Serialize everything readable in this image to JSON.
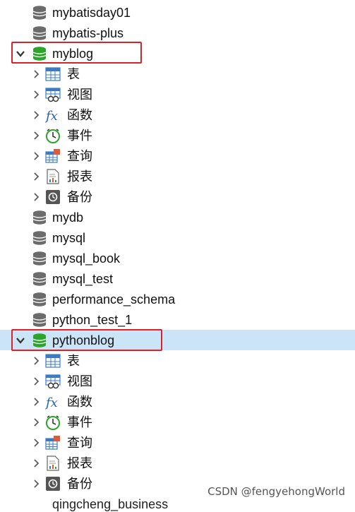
{
  "databases_top": [
    "mybatisday01",
    "mybatis-plus"
  ],
  "myblog": {
    "name": "myblog",
    "children": [
      "表",
      "视图",
      "函数",
      "事件",
      "查询",
      "报表",
      "备份"
    ]
  },
  "databases_mid": [
    "mydb",
    "mysql",
    "mysql_book",
    "mysql_test",
    "performance_schema",
    "python_test_1"
  ],
  "pythonblog": {
    "name": "pythonblog",
    "children": [
      "表",
      "视图",
      "函数",
      "事件",
      "查询",
      "报表",
      "备份"
    ]
  },
  "cut_off_db": "qingcheng_business",
  "watermark": "CSDN @fengyehongWorld",
  "colors": {
    "highlight_border": "#d9222a",
    "selected_row": "#cce4f7",
    "db_active": "#2aa52a",
    "db_inactive": "#666666"
  },
  "icons": [
    "database-icon",
    "table-icon",
    "view-icon",
    "function-icon",
    "event-icon",
    "query-icon",
    "report-icon",
    "backup-icon"
  ]
}
